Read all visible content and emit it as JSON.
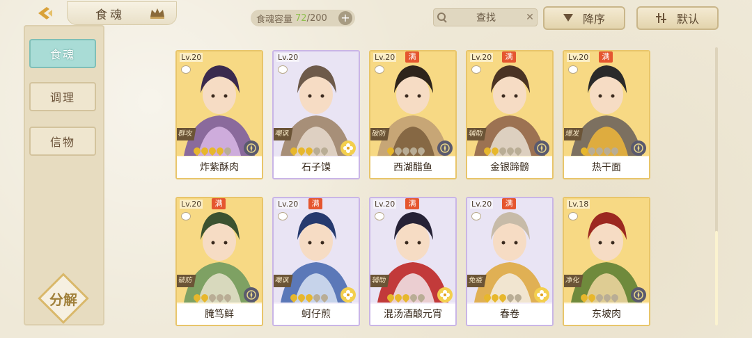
{
  "header": {
    "title": "食魂",
    "capacity_label": "食魂容量",
    "capacity_current": "72",
    "capacity_max": "/200",
    "search_label": "查找",
    "sort_order_label": "降序",
    "sort_mode_label": "默认"
  },
  "sidebar": {
    "tabs": [
      {
        "label": "食魂",
        "active": true
      },
      {
        "label": "调理",
        "active": false
      },
      {
        "label": "信物",
        "active": false
      }
    ],
    "decompose_label": "分解"
  },
  "cards": [
    {
      "level": "Lv.20",
      "full": false,
      "role": "群攻",
      "stars": 4,
      "element": "dark",
      "frame": "gold",
      "name": "炸紫酥肉",
      "palette": [
        "#3a2a4e",
        "#d9b7e8",
        "#8a6a9c"
      ]
    },
    {
      "level": "Lv.20",
      "full": false,
      "role": "嘲讽",
      "stars": 3,
      "element": "light",
      "frame": "purple",
      "name": "石子馍",
      "palette": [
        "#6d5a4a",
        "#e8dccf",
        "#a78f78"
      ]
    },
    {
      "level": "Lv.20",
      "full": true,
      "role": "破防",
      "stars": 1,
      "element": "dark",
      "frame": "gold",
      "name": "西湖醋鱼",
      "palette": [
        "#2e241b",
        "#7a5d3c",
        "#c7a676"
      ]
    },
    {
      "level": "Lv.20",
      "full": true,
      "role": "辅助",
      "stars": 2,
      "element": "dark",
      "frame": "gold",
      "name": "金银蹄髈",
      "palette": [
        "#4a3324",
        "#e9e1d4",
        "#9c7252"
      ]
    },
    {
      "level": "Lv.20",
      "full": true,
      "role": "爆发",
      "stars": 1,
      "element": "dark",
      "frame": "gold",
      "name": "热干面",
      "palette": [
        "#2a2a2a",
        "#f0b63a",
        "#7c7060"
      ]
    },
    {
      "level": "Lv.20",
      "full": true,
      "role": "破防",
      "stars": 2,
      "element": "dark",
      "frame": "gold",
      "name": "腌笃鲜",
      "palette": [
        "#3c5230",
        "#e8e3cc",
        "#7ea163"
      ]
    },
    {
      "level": "Lv.20",
      "full": true,
      "role": "嘲讽",
      "stars": 3,
      "element": "light",
      "frame": "purple",
      "name": "蚵仔煎",
      "palette": [
        "#263a6e",
        "#d9e3f2",
        "#5b78b8"
      ]
    },
    {
      "level": "Lv.20",
      "full": true,
      "role": "辅助",
      "stars": 3,
      "element": "light",
      "frame": "purple",
      "name": "混汤酒酿元宵",
      "palette": [
        "#262236",
        "#f2e9ec",
        "#c23a3a"
      ]
    },
    {
      "level": "Lv.20",
      "full": true,
      "role": "免疫",
      "stars": 3,
      "element": "light",
      "frame": "purple",
      "name": "春卷",
      "palette": [
        "#c7bba8",
        "#f3efe6",
        "#e0b054"
      ]
    },
    {
      "level": "Lv.18",
      "full": false,
      "role": "净化",
      "stars": 2,
      "element": "dark",
      "frame": "gold",
      "name": "东坡肉",
      "palette": [
        "#9c2820",
        "#f2d7a2",
        "#6f8a3c"
      ]
    }
  ],
  "icons": {
    "back": "chevron-left-icon",
    "crown": "crown-icon",
    "search": "magnifier-icon",
    "clear": "close-icon",
    "sort_order": "triangle-down-icon",
    "sort_mode": "filter-icon"
  },
  "colors": {
    "accent_teal": "#a9dcd6",
    "gold_frame": "#e8c56a",
    "purple_frame": "#c9b5e6",
    "full_badge": "#e5562f"
  }
}
